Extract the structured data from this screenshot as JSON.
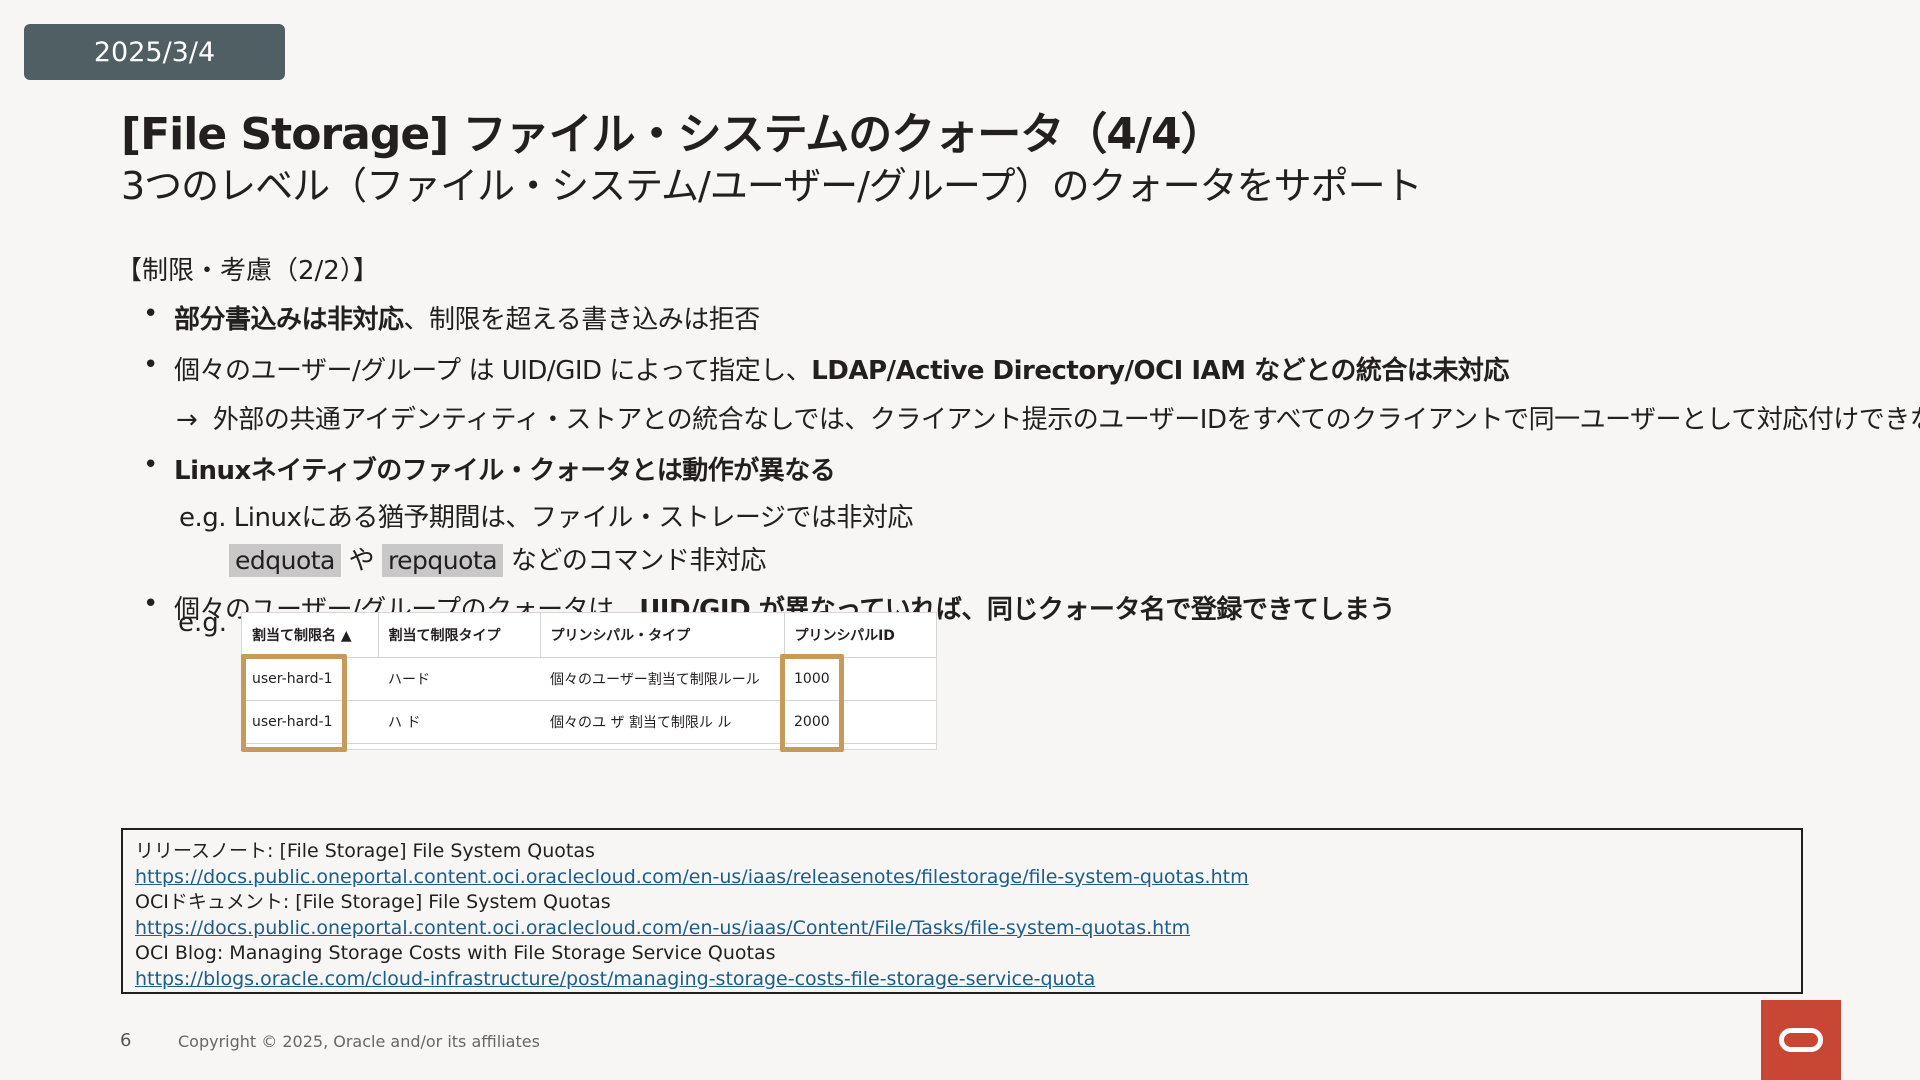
{
  "date": "2025/3/4",
  "title": "[File Storage] ファイル・システムのクォータ（4/4）",
  "subtitle": "3つのレベル（ファイル・システム/ユーザー/グループ）のクォータをサポート",
  "section_heading": "【制限・考慮（2/2）】",
  "bullets": {
    "b1_bold": "部分書込みは非対応",
    "b1_rest": "、制限を超える書き込みは拒否",
    "b2_text": "個々のユーザー/グループ は UID/GID によって指定し、",
    "b2_bold": "LDAP/Active Directory/OCI IAM などとの統合は未対応",
    "b2_arrow": "→",
    "b2_sub": "外部の共通アイデンティティ・ストアとの統合なしでは、クライアント提示のユーザーIDをすべてのクライアントで同一ユーザーとして対応付けできない",
    "b3_bold": "Linuxネイティブのファイル・クォータとは動作が異なる",
    "b3_eg": "e.g. Linuxにある猶予期間は、ファイル・ストレージでは非対応",
    "b3_cmd1": "edquota",
    "b3_ya": "や",
    "b3_cmd2": "repquota",
    "b3_cmd_rest": "などのコマンド非対応",
    "b4_text": "個々のユーザー/グループのクォータは、",
    "b4_bold": "UID/GID が異なっていれば、同じクォータ名で登録できてしまう",
    "b4_eg": "e.g."
  },
  "table": {
    "headers": [
      "割当て制限名 ▲",
      "割当て制限タイプ",
      "プリンシパル・タイプ",
      "プリンシパルID"
    ],
    "rows": [
      [
        "user-hard-1",
        "ハード",
        "個々のユーザー割当て制限ルール",
        "1000"
      ],
      [
        "user-hard-1",
        "ハ  ド",
        "個々のユ  ザ  割当て制限ル  ル",
        "2000"
      ]
    ],
    "highlight_color": "#c89a5a"
  },
  "references": {
    "release_notes_label": "リリースノート: [File Storage] File System Quotas",
    "release_notes_url": "https://docs.public.oneportal.content.oci.oraclecloud.com/en-us/iaas/releasenotes/filestorage/file-system-quotas.htm",
    "docs_label": "OCIドキュメント: [File Storage] File System Quotas",
    "docs_url": "https://docs.public.oneportal.content.oci.oraclecloud.com/en-us/iaas/Content/File/Tasks/file-system-quotas.htm",
    "blog_label": "OCI Blog: Managing Storage Costs with File Storage Service Quotas",
    "blog_url": "https://blogs.oracle.com/cloud-infrastructure/post/managing-storage-costs-file-storage-service-quota"
  },
  "footer": {
    "page_number": "6",
    "copyright": "Copyright © 2025, Oracle and/or its affiliates"
  },
  "colors": {
    "date_badge": "#4f5f63",
    "logo": "#c74634",
    "link": "#1b5e8a"
  }
}
